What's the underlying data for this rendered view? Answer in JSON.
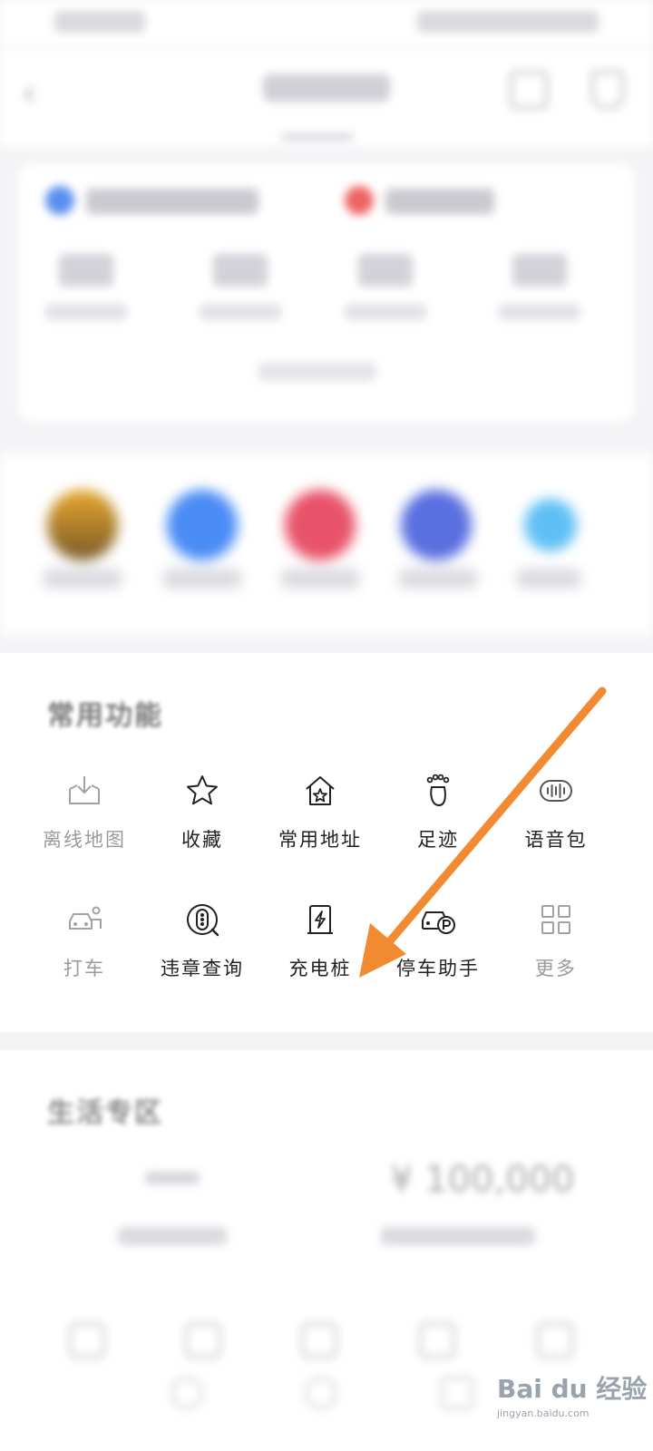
{
  "common_section": {
    "title": "常用功能",
    "items": [
      {
        "label": "离线地图",
        "icon": "offline-map-download-icon",
        "dim": true
      },
      {
        "label": "收藏",
        "icon": "star-icon",
        "dim": false
      },
      {
        "label": "常用地址",
        "icon": "home-star-icon",
        "dim": false
      },
      {
        "label": "足迹",
        "icon": "footprint-icon",
        "dim": false
      },
      {
        "label": "语音包",
        "icon": "voice-wave-icon",
        "dim": false
      },
      {
        "label": "打车",
        "icon": "taxi-icon",
        "dim": true
      },
      {
        "label": "违章查询",
        "icon": "traffic-light-search-icon",
        "dim": false
      },
      {
        "label": "充电桩",
        "icon": "charging-pile-icon",
        "dim": false
      },
      {
        "label": "停车助手",
        "icon": "parking-car-icon",
        "dim": false
      },
      {
        "label": "更多",
        "icon": "grid-more-icon",
        "dim": true
      }
    ]
  },
  "zone_section": {
    "title": "生活专区",
    "price": "¥ 100,000"
  },
  "watermark": {
    "text": "Bai du 经验",
    "sub": "jingyan.baidu.com"
  },
  "colors": {
    "arrow": "#f28a32",
    "blue": "#4a8cf5",
    "red": "#e8536a",
    "indigo": "#5a6fe0"
  }
}
